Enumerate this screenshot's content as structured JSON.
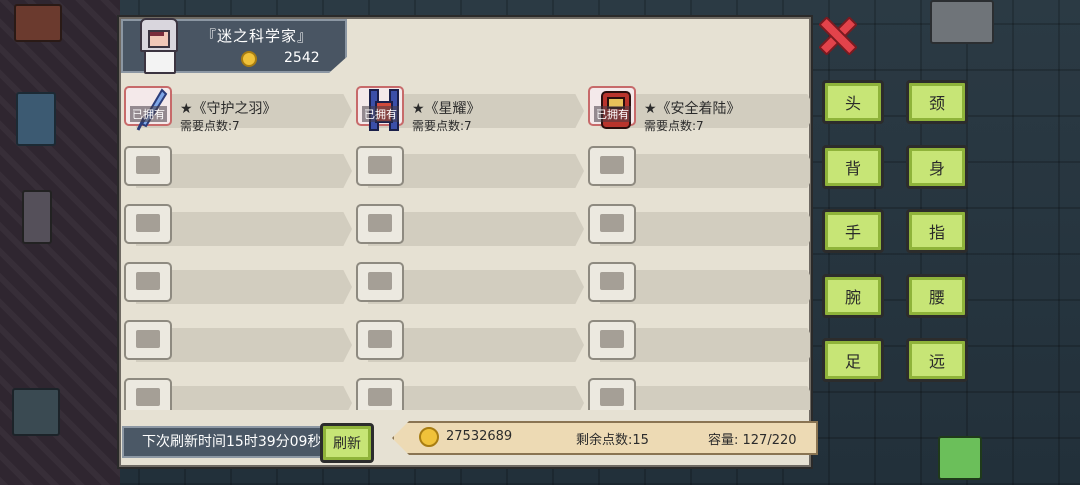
{
  "header": {
    "player_title": "『迷之科学家』",
    "gold": "2542"
  },
  "owned_tag": "已拥有",
  "items": [
    {
      "name": "★《守护之羽》",
      "cost": "需要点数:7",
      "icon": "feather-icon",
      "owned": true
    },
    {
      "name": "★《星耀》",
      "cost": "需要点数:7",
      "icon": "star-armor-icon",
      "owned": true
    },
    {
      "name": "★《安全着陆》",
      "cost": "需要点数:7",
      "icon": "parachute-pack-icon",
      "owned": true
    }
  ],
  "categories": [
    "头",
    "颈",
    "背",
    "身",
    "手",
    "指",
    "腕",
    "腰",
    "足",
    "远"
  ],
  "footer": {
    "refresh_time": "下次刷新时间15时39分09秒",
    "refresh_button": "刷新",
    "total_gold": "27532689",
    "remaining_points": "剩余点数:15",
    "capacity": "容量:  127/220"
  },
  "colors": {
    "accent_green": "#c7e576",
    "panel": "#e6e1d3",
    "close_red": "#e2434b",
    "header_blue": "#495563"
  }
}
